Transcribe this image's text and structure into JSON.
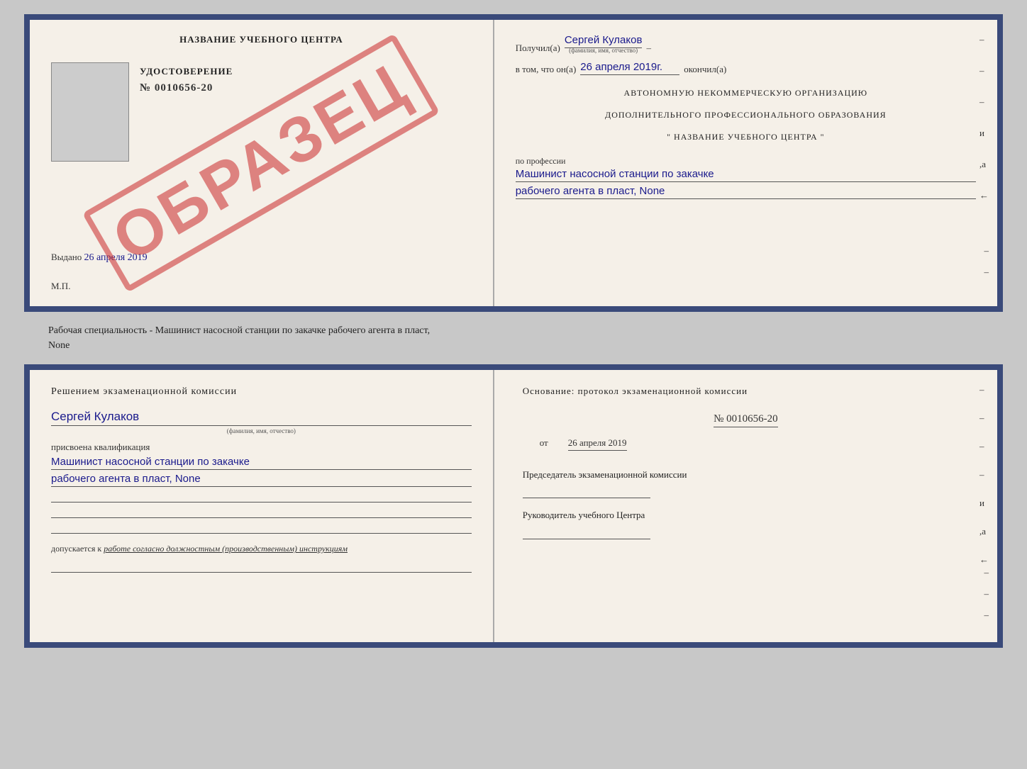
{
  "top_cert": {
    "left": {
      "title": "НАЗВАНИЕ УЧЕБНОГО ЦЕНТРА",
      "photo_placeholder": "",
      "udostoverenie_label": "УДОСТОВЕРЕНИЕ",
      "number": "№ 0010656-20",
      "vidan_label": "Выдано",
      "vidan_date": "26 апреля 2019",
      "mp_label": "М.П.",
      "stamp_text": "ОБРАЗЕЦ"
    },
    "right": {
      "poluchil_label": "Получил(а)",
      "poluchil_value": "Сергей Кулаков",
      "poluchil_sub": "(фамилия, имя, отчество)",
      "dash1": "–",
      "vtom_label": "в том, что он(а)",
      "vtom_value": "26 апреля 2019г.",
      "okonchil_label": "окончил(а)",
      "body_line1": "АВТОНОМНУЮ НЕКОММЕРЧЕСКУЮ ОРГАНИЗАЦИЮ",
      "body_line2": "ДОПОЛНИТЕЛЬНОГО ПРОФЕССИОНАЛЬНОГО ОБРАЗОВАНИЯ",
      "body_line3": "\"   НАЗВАНИЕ УЧЕБНОГО ЦЕНТРА   \"",
      "dash_right1": "–",
      "dash_right2": "–",
      "dash_right3": "–",
      "dash_right4": "и",
      "dash_right5": ",а",
      "dash_right6": "←",
      "po_professii_label": "по профессии",
      "profession_line1": "Машинист насосной станции по закачке",
      "profession_line2": "рабочего агента в пласт, None",
      "dash_right7": "–",
      "dash_right8": "–"
    }
  },
  "specialty_text": "Рабочая специальность - Машинист насосной станции по закачке рабочего агента в пласт,",
  "specialty_text2": "None",
  "bottom_cert": {
    "left": {
      "komissia_text": "Решением экзаменационной комиссии",
      "name_value": "Сергей Кулаков",
      "name_sub": "(фамилия, имя, отчество)",
      "prisvoena_text": "присвоена квалификация",
      "kvalif_line1": "Машинист насосной станции по закачке",
      "kvalif_line2": "рабочего агента в пласт, None",
      "blank1": "",
      "blank2": "",
      "blank3": "",
      "dopuskaetsya_label": "допускается к",
      "dopusk_value": "работе согласно должностным (производственным) инструкциям",
      "blank4": ""
    },
    "right": {
      "osnovanie_text": "Основание: протокол экзаменационной комиссии",
      "protokol_number": "№ 0010656-20",
      "date_prefix": "от",
      "date_value": "26 апреля 2019",
      "dash1": "–",
      "predsedatel_label": "Председатель экзаменационной комиссии",
      "dash2": "–",
      "dash3": "–",
      "dash4": "–",
      "dash5": "и",
      "dash6": ",а",
      "dash7": "←",
      "rukovoditel_label": "Руководитель учебного Центра",
      "dash8": "–",
      "dash9": "–",
      "dash10": "–"
    }
  }
}
